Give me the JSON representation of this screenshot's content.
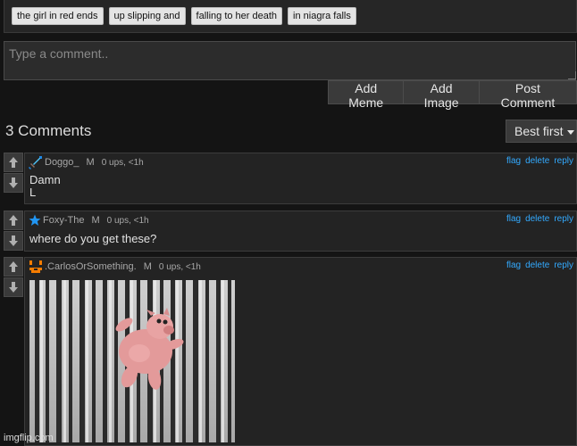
{
  "tags": [
    "the girl in red ends",
    "up slipping and",
    "falling to her death",
    "in niagra falls"
  ],
  "comment_input": {
    "placeholder": "Type a comment.."
  },
  "actions": {
    "add_meme": "Add Meme",
    "add_image": "Add Image",
    "post_comment": "Post Comment"
  },
  "comments_header": {
    "count_label": "3 Comments",
    "sort_label": "Best first"
  },
  "comment_links": {
    "flag": "flag",
    "delete": "delete",
    "reply": "reply"
  },
  "comments": [
    {
      "username": "Doggo_",
      "gender": "M",
      "stats": "0 ups, <1h",
      "lines": [
        "Damn",
        "L"
      ],
      "badge_icon": "pixel-sword-icon"
    },
    {
      "username": "Foxy-The",
      "gender": "M",
      "stats": "0 ups, <1h",
      "lines": [
        "where do you get these?"
      ],
      "badge_icon": "star-icon"
    },
    {
      "username": ".CarlosOrSomething.",
      "gender": "M",
      "stats": "0 ups, <1h",
      "image": "pig-falling-between-tower-columns",
      "badge_icon": "orange-face-icon"
    }
  ],
  "watermark": "imgflip.com",
  "colors": {
    "link": "#33aaff",
    "background": "#141414",
    "panel": "#232323"
  }
}
